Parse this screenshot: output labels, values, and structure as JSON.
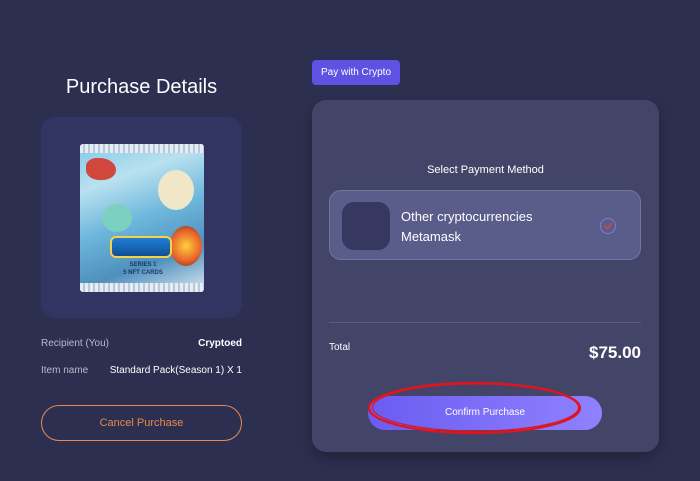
{
  "left": {
    "title": "Purchase Details",
    "product_image": {
      "series_line_1": "SERIES 1",
      "series_line_2": "5 NFT CARDS"
    },
    "recipient": {
      "label": "Recipient (You)",
      "value": "Cryptoed"
    },
    "item": {
      "label": "Item name",
      "value": "Standard Pack(Season 1) X 1"
    },
    "cancel_label": "Cancel Purchase"
  },
  "right": {
    "tab_label": "Pay with Crypto",
    "select_label": "Select Payment Method",
    "method": {
      "line1": "Other cryptocurrencies",
      "line2": "Metamask",
      "selected": true
    },
    "total_label": "Total",
    "total_value": "$75.00",
    "confirm_label": "Confirm Purchase"
  },
  "colors": {
    "background": "#2c2f4f",
    "accent": "#5f52e2",
    "cancel": "#e8894f",
    "annotation": "#e0141f"
  }
}
